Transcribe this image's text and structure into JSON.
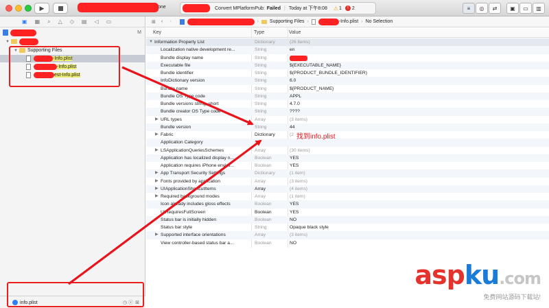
{
  "titlebar": {
    "build_status": "Convert MPlatformPub:",
    "build_result": "Failed",
    "time": "Today at 下午8:08",
    "warning_count": "1",
    "error_count": "2",
    "scheme_suffix": "one",
    "run_icon": "play-icon",
    "stop_icon": "stop-icon"
  },
  "jumpbar": {
    "crumb_folder": "Supporting Files",
    "crumb_file": "-Info.plist",
    "crumb_selection": "No Selection"
  },
  "navigator": {
    "project_badge": "M",
    "group": "Supporting Files",
    "files": [
      "-Info.plist",
      "-Info.plist",
      "est-Info.plist"
    ],
    "filter_value": "info.plist"
  },
  "columns": {
    "key": "Key",
    "type": "Type",
    "value": "Value"
  },
  "rows": [
    {
      "key": "Information Property List",
      "type": "Dictionary",
      "value": "(26 items)",
      "disclosure": "open",
      "indent": 0,
      "val_gray": true
    },
    {
      "key": "Localization native development re...",
      "type": "String",
      "value": "en",
      "indent": 1
    },
    {
      "key": "Bundle display name",
      "type": "String",
      "value": "",
      "indent": 1
    },
    {
      "key": "Executable file",
      "type": "String",
      "value": "${EXECUTABLE_NAME}",
      "indent": 1
    },
    {
      "key": "Bundle identifier",
      "type": "String",
      "value": "$(PRODUCT_BUNDLE_IDENTIFIER)",
      "indent": 1
    },
    {
      "key": "InfoDictionary version",
      "type": "String",
      "value": "6.0",
      "indent": 1
    },
    {
      "key": "Bundle name",
      "type": "String",
      "value": "${PRODUCT_NAME}",
      "indent": 1
    },
    {
      "key": "Bundle OS Type code",
      "type": "String",
      "value": "APPL",
      "indent": 1
    },
    {
      "key": "Bundle versions string, short",
      "type": "String",
      "value": "4.7.0",
      "indent": 1
    },
    {
      "key": "Bundle creator OS Type code",
      "type": "String",
      "value": "????",
      "indent": 1
    },
    {
      "key": "URL types",
      "type": "Array",
      "value": "(3 items)",
      "disclosure": "closed",
      "indent": 1,
      "val_gray": true
    },
    {
      "key": "Bundle version",
      "type": "String",
      "value": "44",
      "indent": 1
    },
    {
      "key": "Fabric",
      "type": "Dictionary",
      "value": "(2",
      "disclosure": "closed",
      "indent": 1,
      "val_gray": true,
      "type_dark": true
    },
    {
      "key": "Application Category",
      "type": "St",
      "value": "",
      "indent": 1
    },
    {
      "key": "LSApplicationQueriesSchemes",
      "type": "Array",
      "value": "(30 items)",
      "disclosure": "closed",
      "indent": 1,
      "val_gray": true
    },
    {
      "key": "Application has localized display n...",
      "type": "Boolean",
      "value": "YES",
      "indent": 1
    },
    {
      "key": "Application requires iPhone enviro...",
      "type": "Boolean",
      "value": "YES",
      "indent": 1
    },
    {
      "key": "App Transport Security Settings",
      "type": "Dictionary",
      "value": "(1 item)",
      "disclosure": "closed",
      "indent": 1,
      "val_gray": true
    },
    {
      "key": "Fonts provided by application",
      "type": "Array",
      "value": "(3 items)",
      "disclosure": "closed",
      "indent": 1,
      "val_gray": true
    },
    {
      "key": "UIApplicationShortcutItems",
      "type": "Array",
      "value": "(4 items)",
      "disclosure": "closed",
      "indent": 1,
      "val_gray": true,
      "type_dark": true
    },
    {
      "key": "Required background modes",
      "type": "Array",
      "value": "(1 item)",
      "disclosure": "closed",
      "indent": 1,
      "val_gray": true
    },
    {
      "key": "Icon already includes gloss effects",
      "type": "Boolean",
      "value": "YES",
      "indent": 1
    },
    {
      "key": "UIRequiresFullScreen",
      "type": "Boolean",
      "value": "YES",
      "indent": 1,
      "type_dark": true
    },
    {
      "key": "Status bar is initially hidden",
      "type": "Boolean",
      "value": "NO",
      "indent": 1
    },
    {
      "key": "Status bar style",
      "type": "String",
      "value": "Opaque black style",
      "indent": 1
    },
    {
      "key": "Supported interface orientations",
      "type": "Array",
      "value": "(3 items)",
      "disclosure": "closed",
      "indent": 1,
      "val_gray": true
    },
    {
      "key": "View controller-based status bar a...",
      "type": "Boolean",
      "value": "NO",
      "indent": 1
    }
  ],
  "annotation": {
    "text": "找到info.plist"
  },
  "watermark": {
    "brand": "aspku",
    "dot_com": ".com",
    "subtitle": "免费网站源码下载站!"
  },
  "colors": {
    "accent": "#e8141b",
    "selection": "#dfe6ef",
    "build_failed": "#000000",
    "warning": "#f5a623",
    "error": "#e0302a"
  }
}
